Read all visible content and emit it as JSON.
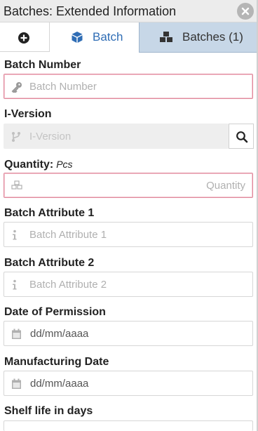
{
  "window": {
    "title": "Batches: Extended Information"
  },
  "tabs": {
    "batch_label": "Batch",
    "batches_label": "Batches (1)"
  },
  "fields": {
    "batch_number": {
      "label": "Batch Number",
      "placeholder": "Batch Number"
    },
    "i_version": {
      "label": "I-Version",
      "placeholder": "I-Version"
    },
    "quantity": {
      "label": "Quantity:",
      "unit": "Pcs",
      "placeholder": "Quantity"
    },
    "batch_attribute_1": {
      "label": "Batch Attribute 1",
      "placeholder": "Batch Attribute 1"
    },
    "batch_attribute_2": {
      "label": "Batch Attribute 2",
      "placeholder": "Batch Attribute 2"
    },
    "date_of_permission": {
      "label": "Date of Permission",
      "value": "dd/mm/aaaa"
    },
    "manufacturing_date": {
      "label": "Manufacturing Date",
      "value": "dd/mm/aaaa"
    },
    "shelf_life": {
      "label": "Shelf life in days"
    }
  },
  "colors": {
    "accent": "#2f6db5",
    "inactive_tab": "#c7d7e7",
    "required_border": "#e0899c"
  },
  "icons": [
    "close-icon",
    "plus-circle-icon",
    "cube-icon",
    "cubes-icon",
    "key-icon",
    "branch-icon",
    "search-icon",
    "info-icon",
    "calendar-icon"
  ]
}
